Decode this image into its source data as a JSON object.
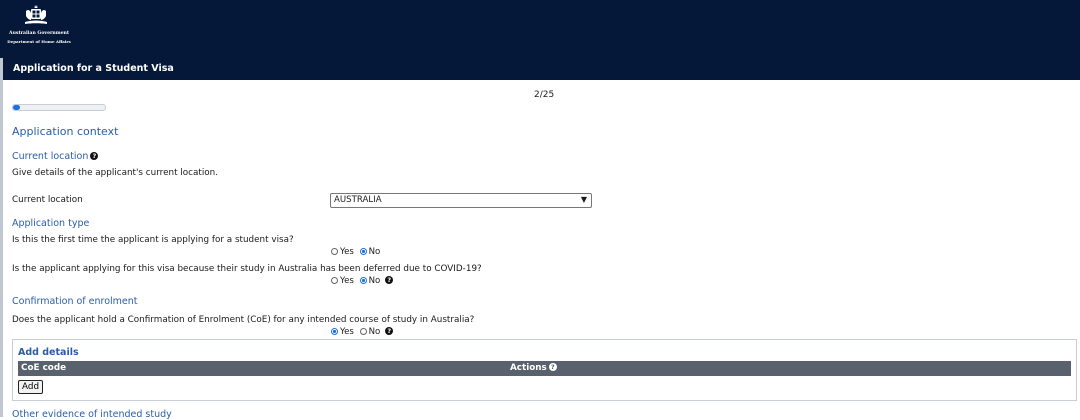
{
  "header": {
    "logo": "australian-government-crest-icon",
    "agency_line1": "Australian Government",
    "agency_line2": "Department of Home Affairs",
    "title": "Application for a Student Visa",
    "colors": {
      "banner": "#06183a",
      "accent": "#2a5da8",
      "progress": "#1b72d8"
    }
  },
  "progress": {
    "page": "2/25",
    "fraction": 0.08
  },
  "section_title": "Application context",
  "current_location": {
    "heading": "Current location",
    "help_icon": "question-circle-icon",
    "description": "Give details of the applicant's current location.",
    "field_label": "Current location",
    "selected_value": "AUSTRALIA"
  },
  "application_type": {
    "heading": "Application type",
    "q1": "Is this the first time the applicant is applying for a student visa?",
    "q1_options": [
      "Yes",
      "No"
    ],
    "q1_selected": "No",
    "q2": "Is the applicant applying for this visa because their study in Australia has been deferred due to COVID-19?",
    "q2_options": [
      "Yes",
      "No"
    ],
    "q2_selected": "No"
  },
  "enrolment": {
    "heading": "Confirmation of enrolment",
    "q": "Does the applicant hold a Confirmation of Enrolment (CoE) for any intended course of study in Australia?",
    "options": [
      "Yes",
      "No"
    ],
    "selected": "Yes",
    "panel_title": "Add details",
    "columns": [
      "CoE code",
      "Actions"
    ],
    "add_label": "Add"
  },
  "next_section_partial": "Other evidence of intended study"
}
